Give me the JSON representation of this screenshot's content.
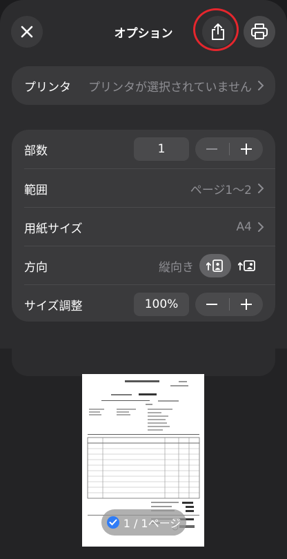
{
  "header": {
    "title": "オプション"
  },
  "printer": {
    "label": "プリンタ",
    "value": "プリンタが選択されていません"
  },
  "options": {
    "copies": {
      "label": "部数",
      "value": "1"
    },
    "range": {
      "label": "範囲",
      "value": "ページ1〜2"
    },
    "paper_size": {
      "label": "用紙サイズ",
      "value": "A4"
    },
    "orientation": {
      "label": "方向",
      "value": "縦向き",
      "selected": "portrait"
    },
    "scale": {
      "label": "サイズ調整",
      "value": "100%"
    }
  },
  "preview": {
    "page_badge": "1 / 1ページ"
  },
  "icons": [
    "close-icon",
    "share-icon",
    "printer-icon",
    "chevron-right-icon",
    "minus-icon",
    "plus-icon",
    "portrait-icon",
    "landscape-icon",
    "checkmark-icon"
  ],
  "colors": {
    "accent": "#2f7cf6",
    "highlight_ring": "#e5262d",
    "sheet": "#2c2c2e",
    "card": "#3a3a3c"
  }
}
